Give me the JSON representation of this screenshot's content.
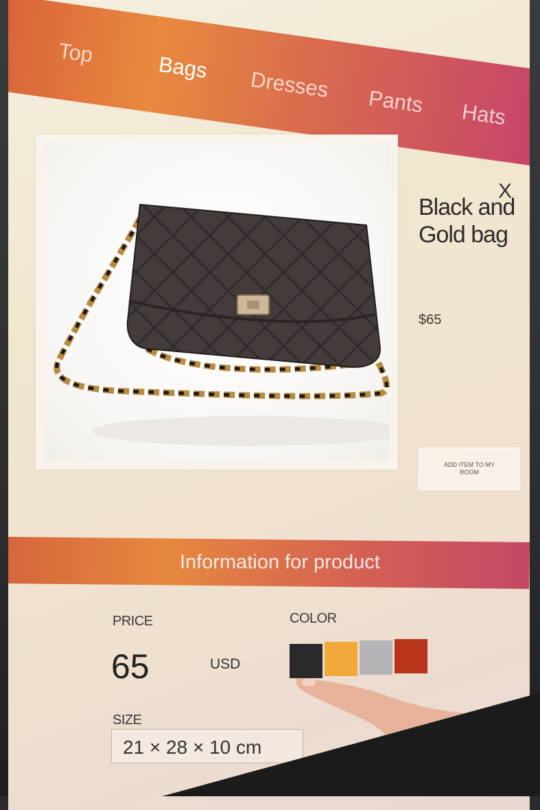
{
  "nav": {
    "items": [
      {
        "label": "Top",
        "active": false
      },
      {
        "label": "Bags",
        "active": true
      },
      {
        "label": "Dresses",
        "active": false
      },
      {
        "label": "Pants",
        "active": false
      },
      {
        "label": "Hats",
        "active": false
      }
    ]
  },
  "product": {
    "close_label": "X",
    "title": "Black and Gold bag",
    "price": "$65",
    "add_button": "ADD ITEM TO MY ROOM",
    "image_icon": "quilted-handbag-image"
  },
  "info": {
    "band_title": "Information for product",
    "price_label": "PRICE",
    "price_value": "65",
    "currency": "USD",
    "color_label": "COLOR",
    "colors": [
      "#2a2a2c",
      "#f2a93a",
      "#b4b4b6",
      "#b8341a"
    ],
    "size_label": "SIZE",
    "size_value": "21 × 28 × 10 cm"
  },
  "colors": {
    "nav_start": "#d8603a",
    "nav_mid": "#e88a3f",
    "nav_end": "#c6446a"
  }
}
